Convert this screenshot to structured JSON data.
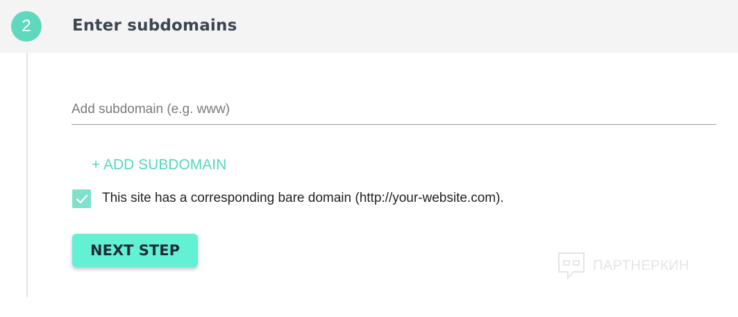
{
  "step": {
    "number": "2",
    "title": "Enter subdomains"
  },
  "subdomain_input": {
    "placeholder": "Add subdomain (e.g. www)",
    "value": ""
  },
  "add_subdomain_label": "+ ADD SUBDOMAIN",
  "bare_domain_checkbox": {
    "checked": true,
    "label": "This site has a corresponding bare domain (http://your-website.com)."
  },
  "next_step_label": "NEXT STEP",
  "watermark": {
    "text": "ПАРТНЕРКИН"
  },
  "colors": {
    "accent": "#5fd8bf",
    "button": "#63f1d4",
    "link": "#55d6bd",
    "checkbox": "#7fe0cc",
    "header_bg": "#f4f4f4"
  }
}
